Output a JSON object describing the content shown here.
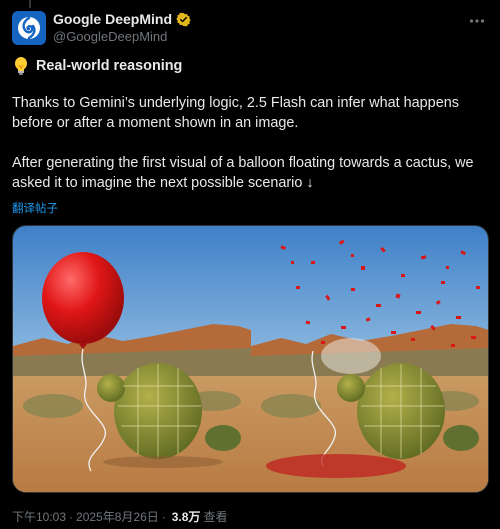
{
  "author": {
    "name": "Google DeepMind",
    "handle": "@GoogleDeepMind"
  },
  "tweet": {
    "headline": "Real-world reasoning",
    "paragraph1": "Thanks to Gemini’s underlying logic, 2.5 Flash can infer what happens before or after a moment shown in an image.",
    "paragraph2": "After generating the first visual of a balloon floating towards a cactus, we asked it to imagine the next possible scenario ↓",
    "translate_label": "翻译帖子"
  },
  "meta": {
    "time": "下午10:03",
    "date": "2025年8月26日",
    "views_count": "3.8万",
    "views_label": "查看"
  },
  "icons": {
    "verified": "verified-badge-icon",
    "more": "more-icon",
    "bulb": "light-bulb-icon"
  },
  "colors": {
    "background": "#000000",
    "text": "#e7e9ea",
    "secondary": "#71767b",
    "link": "#1d9bf0",
    "verified_gold": "#e2b719"
  }
}
